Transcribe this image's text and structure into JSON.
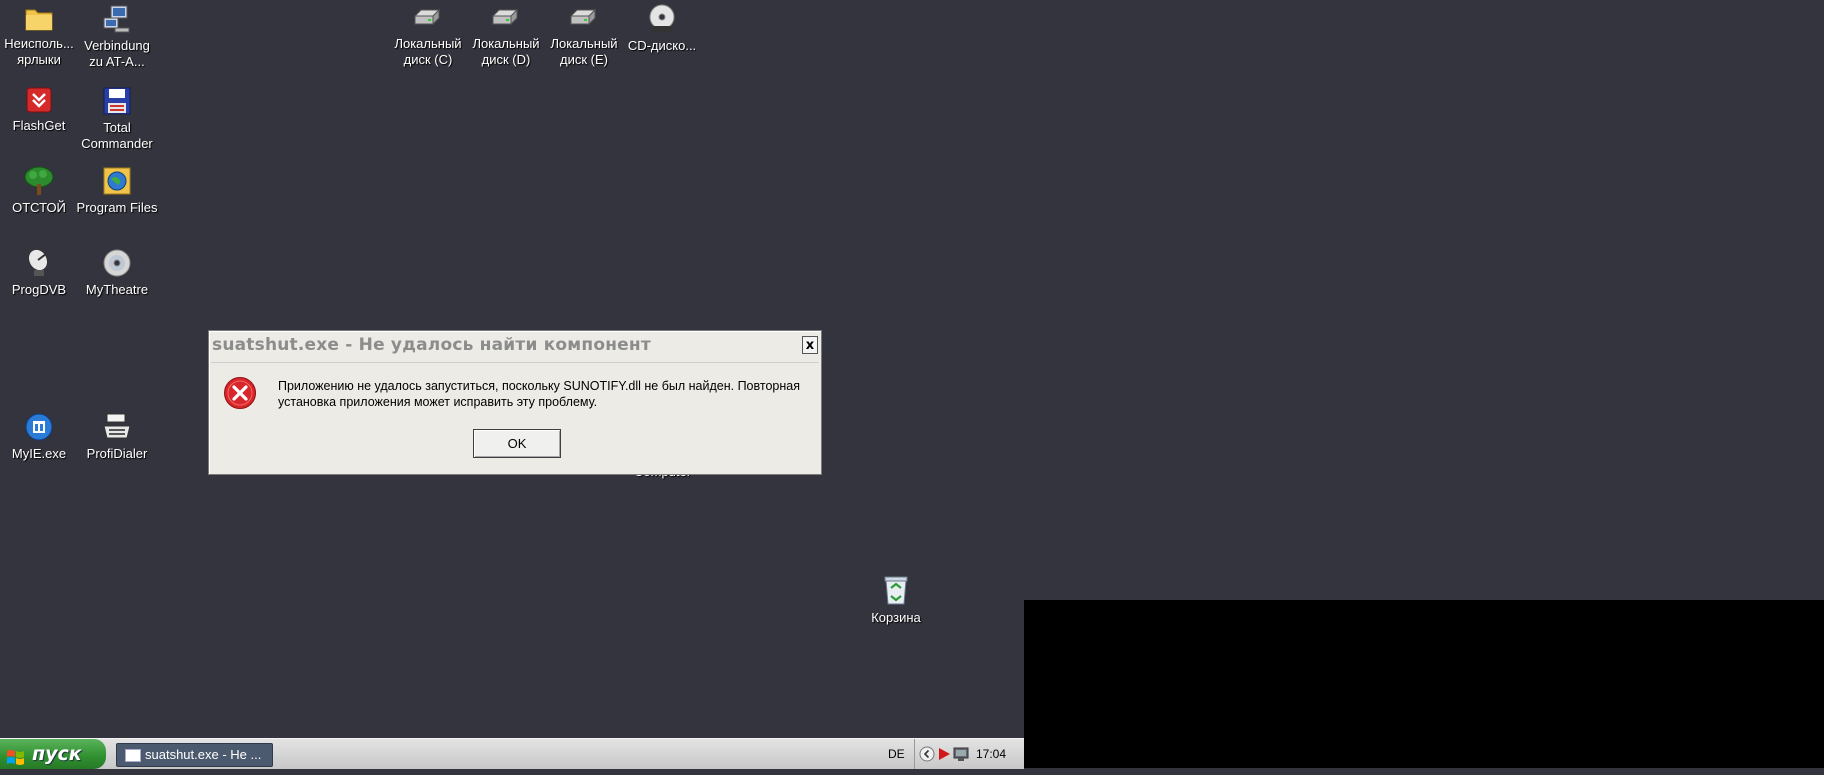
{
  "desktop_icons": {
    "unused_shortcuts": "Неисполь... ярлыки",
    "verbindung": "Verbindung zu AT-A...",
    "flashget": "FlashGet",
    "total_commander": "Total Commander",
    "otstoy": "ОТСТОЙ",
    "program_files": "Program Files",
    "progdvb": "ProgDVB",
    "mytheatre": "MyTheatre",
    "myie": "MyIE.exe",
    "profidialer": "ProfiDialer",
    "disk_c": "Локальный диск (C)",
    "disk_d": "Локальный диск (D)",
    "disk_e": "Локальный диск (E)",
    "cd_drive": "CD-диско...",
    "recycle_bin": "Корзина",
    "hidden_label": "Computer"
  },
  "dialog": {
    "title": "suatshut.exe - Не удалось найти компонент",
    "close": "x",
    "message": "Приложению не удалось запуститься, поскольку SUNOTIFY.dll не был найден. Повторная установка приложения может исправить эту проблему.",
    "ok_label": "OK"
  },
  "taskbar": {
    "start_label": "пуск",
    "task_label": "suatshut.exe - Не ...",
    "language": "DE",
    "clock": "17:04"
  },
  "colors": {
    "desktop_bg": "#34343e",
    "error_red": "#d8262b",
    "start_green": "#2f8f2f",
    "task_button": "#4c5a70"
  }
}
